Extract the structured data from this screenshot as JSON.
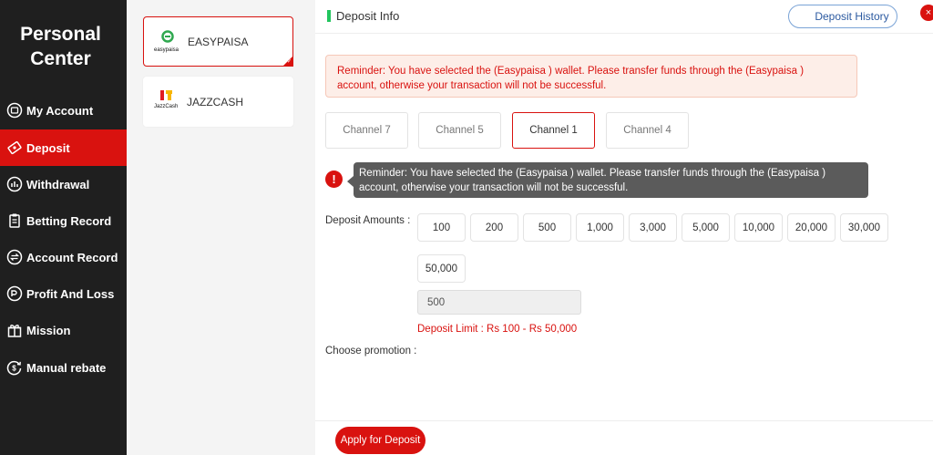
{
  "sidebar": {
    "title": "Personal Center",
    "items": [
      {
        "label": "My Account",
        "icon": "account-icon"
      },
      {
        "label": "Deposit",
        "icon": "deposit-icon"
      },
      {
        "label": "Withdrawal",
        "icon": "withdrawal-icon"
      },
      {
        "label": "Betting Record",
        "icon": "betting-record-icon"
      },
      {
        "label": "Account Record",
        "icon": "account-record-icon"
      },
      {
        "label": "Profit And Loss",
        "icon": "profit-loss-icon"
      },
      {
        "label": "Mission",
        "icon": "gift-icon"
      },
      {
        "label": "Manual rebate",
        "icon": "rebate-icon"
      }
    ],
    "active_item": "Deposit"
  },
  "wallets": [
    {
      "name": "EASYPAISA",
      "logo_text": "easypaisa",
      "selected": true
    },
    {
      "name": "JAZZCASH",
      "logo_text": "JazzCash",
      "selected": false
    }
  ],
  "header": {
    "title": "Deposit Info",
    "history_label": "Deposit History",
    "close_label": "×"
  },
  "reminder": "Reminder: You have selected the (Easypaisa ) wallet. Please transfer funds through the (Easypaisa ) account, otherwise your transaction will not be successful.",
  "channels": [
    {
      "label": "Channel 7",
      "active": false
    },
    {
      "label": "Channel 5",
      "active": false
    },
    {
      "label": "Channel 1",
      "active": true
    },
    {
      "label": "Channel 4",
      "active": false
    }
  ],
  "tooltip": {
    "icon": "!",
    "text": "Reminder: You have selected the (Easypaisa ) wallet. Please transfer funds through the (Easypaisa ) account, otherwise your transaction will not be successful."
  },
  "deposit": {
    "amounts_label": "Deposit Amounts :",
    "amounts": [
      "100",
      "200",
      "500",
      "1,000",
      "3,000",
      "5,000",
      "10,000",
      "20,000",
      "30,000",
      "50,000"
    ],
    "input_value": "500",
    "limit_text": "Deposit Limit :  Rs  100  -  Rs  50,000",
    "promotion_label": "Choose promotion :"
  },
  "footer": {
    "apply_label": "Apply for Deposit"
  },
  "colors": {
    "accent": "#d9120f",
    "sidebar_bg": "#1f1f1f",
    "header_marker": "#22c55e"
  }
}
